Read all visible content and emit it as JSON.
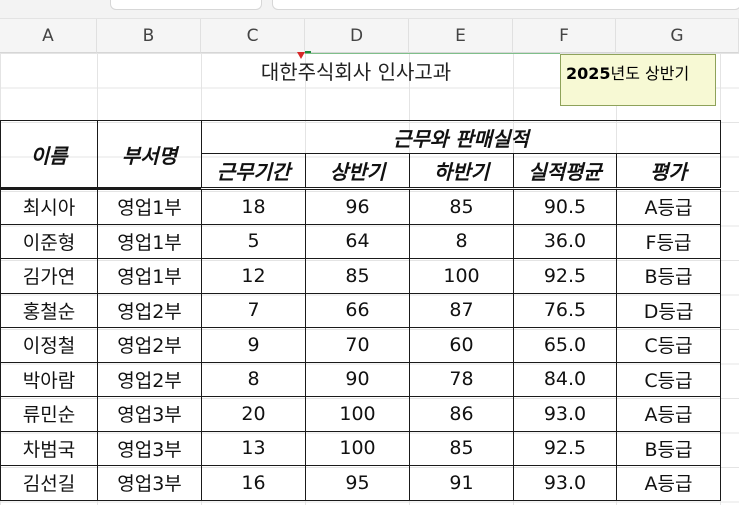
{
  "columns": [
    "A",
    "B",
    "C",
    "D",
    "E",
    "F",
    "G"
  ],
  "sheet": {
    "title": "대한주식회사 인사고과",
    "note_bold": "2025",
    "note_rest": "년도 상반기"
  },
  "table": {
    "name_header": "이름",
    "dept_header": "부서명",
    "group_header": "근무와 판매실적",
    "sub_headers": [
      "근무기간",
      "상반기",
      "하반기",
      "실적평균",
      "평가"
    ],
    "rows": [
      [
        "최시아",
        "영업1부",
        "18",
        "96",
        "85",
        "90.5",
        "A등급"
      ],
      [
        "이준형",
        "영업1부",
        "5",
        "64",
        "8",
        "36.0",
        "F등급"
      ],
      [
        "김가연",
        "영업1부",
        "12",
        "85",
        "100",
        "92.5",
        "B등급"
      ],
      [
        "홍철순",
        "영업2부",
        "7",
        "66",
        "87",
        "76.5",
        "D등급"
      ],
      [
        "이정철",
        "영업2부",
        "9",
        "70",
        "60",
        "65.0",
        "C등급"
      ],
      [
        "박아람",
        "영업2부",
        "8",
        "90",
        "78",
        "84.0",
        "C등급"
      ],
      [
        "류민순",
        "영업3부",
        "20",
        "100",
        "86",
        "93.0",
        "A등급"
      ],
      [
        "차범국",
        "영업3부",
        "13",
        "100",
        "85",
        "92.5",
        "B등급"
      ],
      [
        "김선길",
        "영업3부",
        "16",
        "95",
        "91",
        "93.0",
        "A등급"
      ]
    ]
  }
}
